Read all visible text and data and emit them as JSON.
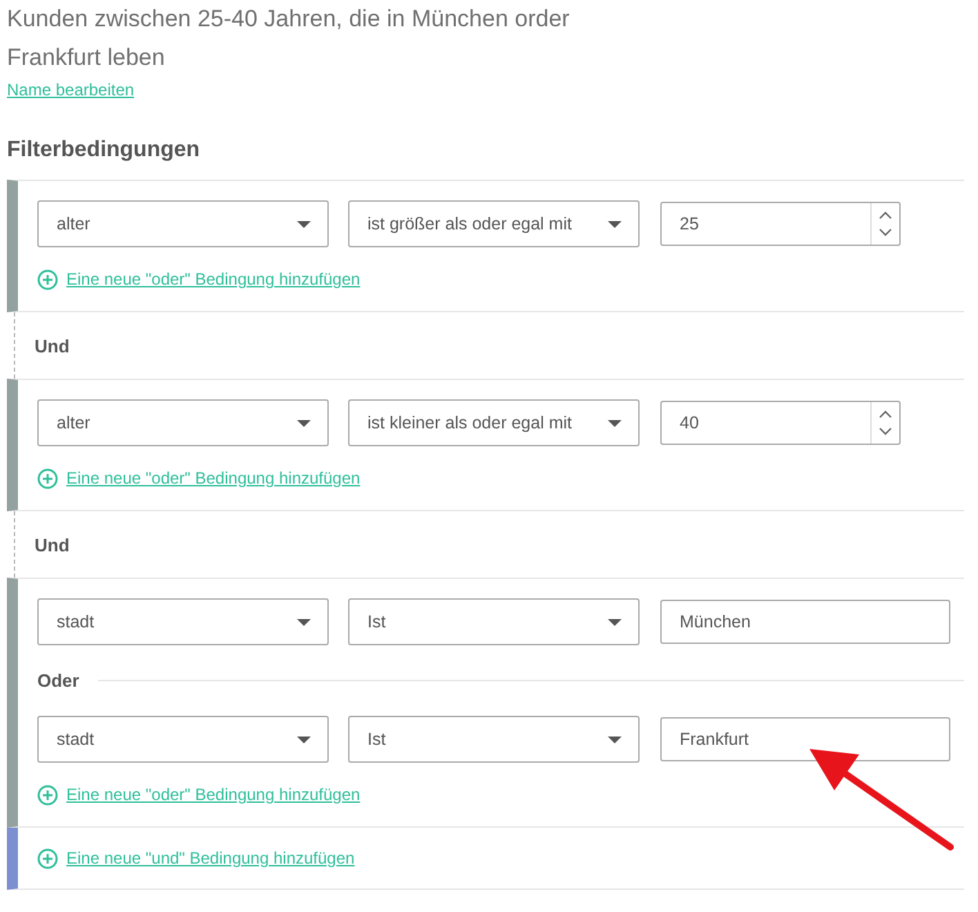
{
  "title": "Kunden zwischen 25-40 Jahren, die in München order Frankfurt leben",
  "edit_link": "Name bearbeiten",
  "heading": "Filterbedingungen",
  "groups": [
    {
      "kind": "conditions",
      "items": [
        {
          "kind": "condition",
          "field": "alter",
          "operator": "ist größer als oder egal mit",
          "value": "25",
          "stepper": true
        }
      ],
      "add_or": "Eine neue \"oder\" Bedingung hinzufügen"
    },
    {
      "kind": "connector",
      "label": "Und"
    },
    {
      "kind": "conditions",
      "items": [
        {
          "kind": "condition",
          "field": "alter",
          "operator": "ist kleiner als oder egal mit",
          "value": "40",
          "stepper": true
        }
      ],
      "add_or": "Eine neue \"oder\" Bedingung hinzufügen"
    },
    {
      "kind": "connector",
      "label": "Und"
    },
    {
      "kind": "conditions",
      "items": [
        {
          "kind": "condition",
          "field": "stadt",
          "operator": "Ist",
          "value": "München",
          "stepper": false
        },
        {
          "kind": "separator",
          "label": "Oder"
        },
        {
          "kind": "condition",
          "field": "stadt",
          "operator": "Ist",
          "value": "Frankfurt",
          "stepper": false
        }
      ],
      "add_or": "Eine neue \"oder\" Bedingung hinzufügen"
    },
    {
      "kind": "add",
      "label": "Eine neue \"und\" Bedingung hinzufügen"
    }
  ]
}
